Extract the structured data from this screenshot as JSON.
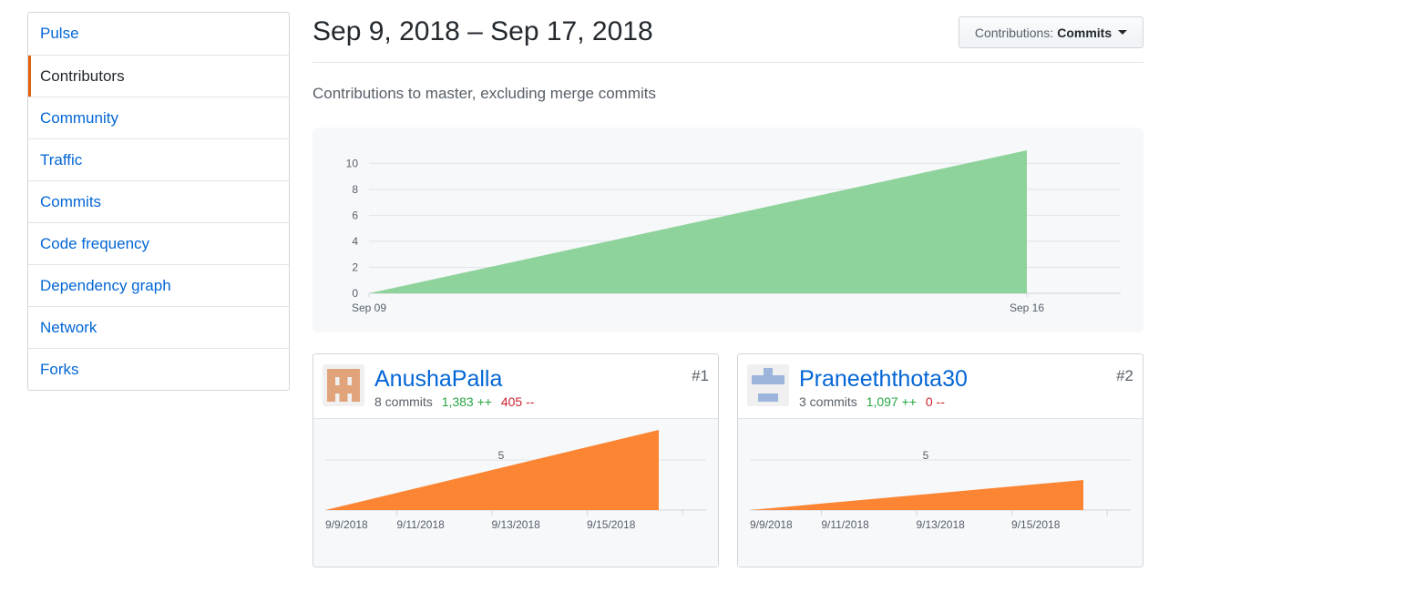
{
  "sidebar": {
    "items": [
      {
        "label": "Pulse"
      },
      {
        "label": "Contributors",
        "selected": true
      },
      {
        "label": "Community"
      },
      {
        "label": "Traffic"
      },
      {
        "label": "Commits"
      },
      {
        "label": "Code frequency"
      },
      {
        "label": "Dependency graph"
      },
      {
        "label": "Network"
      },
      {
        "label": "Forks"
      }
    ]
  },
  "header": {
    "title": "Sep 9, 2018 – Sep 17, 2018",
    "dropdown_label": "Contributions:",
    "dropdown_value": "Commits"
  },
  "subtitle": "Contributions to master, excluding merge commits",
  "colors": {
    "accent": "#e36209",
    "main_area": "#7ccc8b",
    "contributor_area": "#fb8532",
    "link": "#0366d6",
    "additions": "#28a745",
    "deletions": "#cb2431"
  },
  "contributors": [
    {
      "name": "AnushaPalla",
      "rank": "#1",
      "commits": "8 commits",
      "additions": "1,383 ++",
      "deletions": "405 --",
      "avatar_icon": "identicon-orange"
    },
    {
      "name": "Praneeththota30",
      "rank": "#2",
      "commits": "3 commits",
      "additions": "1,097 ++",
      "deletions": "0 --",
      "avatar_icon": "identicon-blue"
    }
  ],
  "chart_data": [
    {
      "type": "area",
      "x": [
        "2018-09-09",
        "2018-09-16"
      ],
      "series": [
        {
          "values": [
            0,
            11
          ]
        }
      ],
      "y_ticks": [
        0,
        2,
        4,
        6,
        8,
        10
      ],
      "x_tick_labels": [
        "Sep 09",
        "Sep 16"
      ],
      "ylim": [
        0,
        11
      ],
      "grid": true
    },
    {
      "type": "area",
      "x": [
        "2018-09-09",
        "2018-09-16"
      ],
      "series": [
        {
          "name": "AnushaPalla",
          "values": [
            0,
            8
          ]
        }
      ],
      "y_ticks": [
        5
      ],
      "x_tick_labels": [
        "9/9/2018",
        "9/11/2018",
        "9/13/2018",
        "9/15/2018"
      ],
      "ylim": [
        0,
        8
      ],
      "grid": true
    },
    {
      "type": "area",
      "x": [
        "2018-09-09",
        "2018-09-16"
      ],
      "series": [
        {
          "name": "Praneeththota30",
          "values": [
            0,
            3
          ]
        }
      ],
      "y_ticks": [
        5
      ],
      "x_tick_labels": [
        "9/9/2018",
        "9/11/2018",
        "9/13/2018",
        "9/15/2018"
      ],
      "ylim": [
        0,
        8
      ],
      "grid": true
    }
  ]
}
